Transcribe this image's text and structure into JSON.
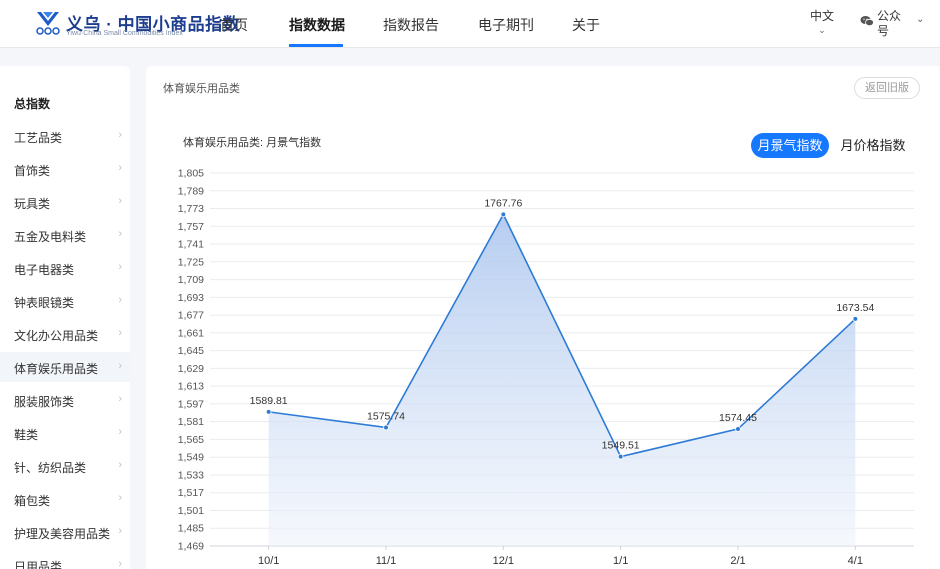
{
  "header": {
    "logo": {
      "cn": "义乌 · 中国小商品指数",
      "en": "Yiwu·China Small Commodities Index"
    },
    "nav": [
      {
        "label": "首页",
        "active": false
      },
      {
        "label": "指数数据",
        "active": true
      },
      {
        "label": "指数报告",
        "active": false
      },
      {
        "label": "电子期刊",
        "active": false
      },
      {
        "label": "关于",
        "active": false
      }
    ],
    "language": "中文",
    "wechat_label": "公众号"
  },
  "sidebar": {
    "title": "总指数",
    "items": [
      {
        "label": "工艺品类"
      },
      {
        "label": "首饰类"
      },
      {
        "label": "玩具类"
      },
      {
        "label": "五金及电料类"
      },
      {
        "label": "电子电器类"
      },
      {
        "label": "钟表眼镜类"
      },
      {
        "label": "文化办公用品类"
      },
      {
        "label": "体育娱乐用品类",
        "active": true
      },
      {
        "label": "服装服饰类"
      },
      {
        "label": "鞋类"
      },
      {
        "label": "针、纺织品类"
      },
      {
        "label": "箱包类"
      },
      {
        "label": "护理及美容用品类"
      },
      {
        "label": "日用品类"
      }
    ]
  },
  "main": {
    "breadcrumb": "体育娱乐用品类",
    "back_button": "返回旧版",
    "chart_title": "体育娱乐用品类: 月景气指数",
    "tabs": [
      {
        "label": "月景气指数",
        "active": true
      },
      {
        "label": "月价格指数",
        "active": false
      }
    ]
  },
  "colors": {
    "accent": "#1677ff",
    "line": "#2e7bd6",
    "area_top": "#a9c4ee",
    "area_bottom": "#eef3fb"
  },
  "chart_data": {
    "type": "area",
    "categories": [
      "10/1",
      "11/1",
      "12/1",
      "1/1",
      "2/1",
      "4/1"
    ],
    "values": [
      1589.81,
      1575.74,
      1767.76,
      1549.51,
      1574.45,
      1673.54
    ],
    "value_labels": [
      "1589.81",
      "1575.74",
      "1767.76",
      "1549.51",
      "1574.45",
      "1673.54"
    ],
    "yticks": [
      "1,469",
      "1,485",
      "1,501",
      "1,517",
      "1,533",
      "1,549",
      "1,565",
      "1,581",
      "1,597",
      "1,613",
      "1,629",
      "1,645",
      "1,661",
      "1,677",
      "1,693",
      "1,709",
      "1,725",
      "1,741",
      "1,757",
      "1,773",
      "1,789",
      "1,805"
    ],
    "ylim": [
      1469,
      1805
    ],
    "grid": true,
    "legend": "none"
  }
}
